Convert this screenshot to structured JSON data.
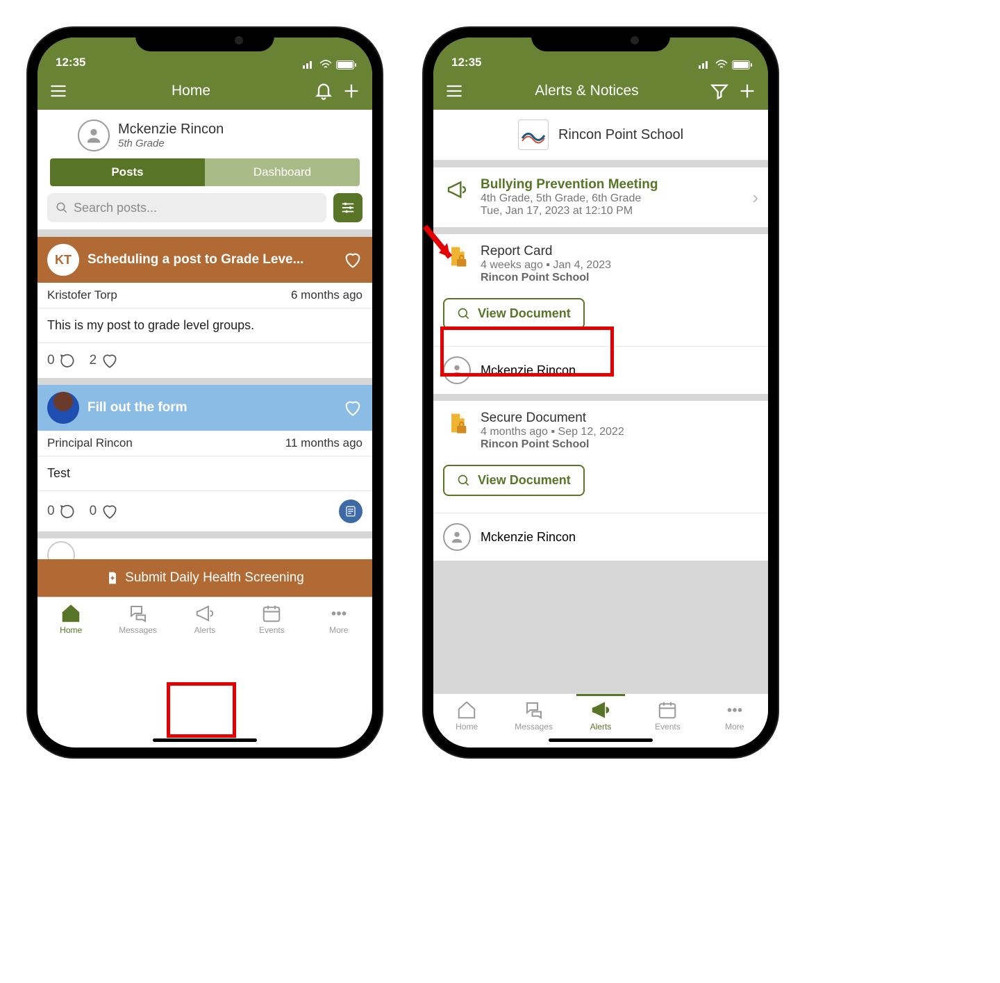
{
  "status": {
    "time": "12:35"
  },
  "phone1": {
    "appbar": {
      "title": "Home"
    },
    "profile": {
      "name": "Mckenzie Rincon",
      "grade": "5th Grade"
    },
    "tabs": {
      "posts": "Posts",
      "dashboard": "Dashboard"
    },
    "search": {
      "placeholder": "Search posts..."
    },
    "post1": {
      "avatar": "KT",
      "title": "Scheduling a post to Grade Leve...",
      "author": "Kristofer Torp",
      "age": "6 months ago",
      "body": "This is my post to grade level groups.",
      "comments": "0",
      "likes": "2"
    },
    "post2": {
      "title": "Fill out the form",
      "author": "Principal Rincon",
      "age": "11 months ago",
      "body": "Test",
      "comments": "0",
      "likes": "0"
    },
    "banner": "Submit Daily Health Screening",
    "nav": {
      "home": "Home",
      "messages": "Messages",
      "alerts": "Alerts",
      "events": "Events",
      "more": "More"
    }
  },
  "phone2": {
    "appbar": {
      "title": "Alerts & Notices"
    },
    "school": "Rincon Point School",
    "alert1": {
      "title": "Bullying Prevention Meeting",
      "sub1": "4th Grade, 5th Grade, 6th Grade",
      "sub2": "Tue, Jan 17, 2023 at 12:10 PM"
    },
    "alert2": {
      "title": "Report Card",
      "sub1": "4 weeks ago ▪ Jan 4, 2023",
      "sub2": "Rincon Point School"
    },
    "viewdoc": "View Document",
    "person": "Mckenzie Rincon",
    "alert3": {
      "title": "Secure Document",
      "sub1": "4 months ago ▪ Sep 12, 2022",
      "sub2": "Rincon Point School"
    },
    "nav": {
      "home": "Home",
      "messages": "Messages",
      "alerts": "Alerts",
      "events": "Events",
      "more": "More"
    }
  }
}
